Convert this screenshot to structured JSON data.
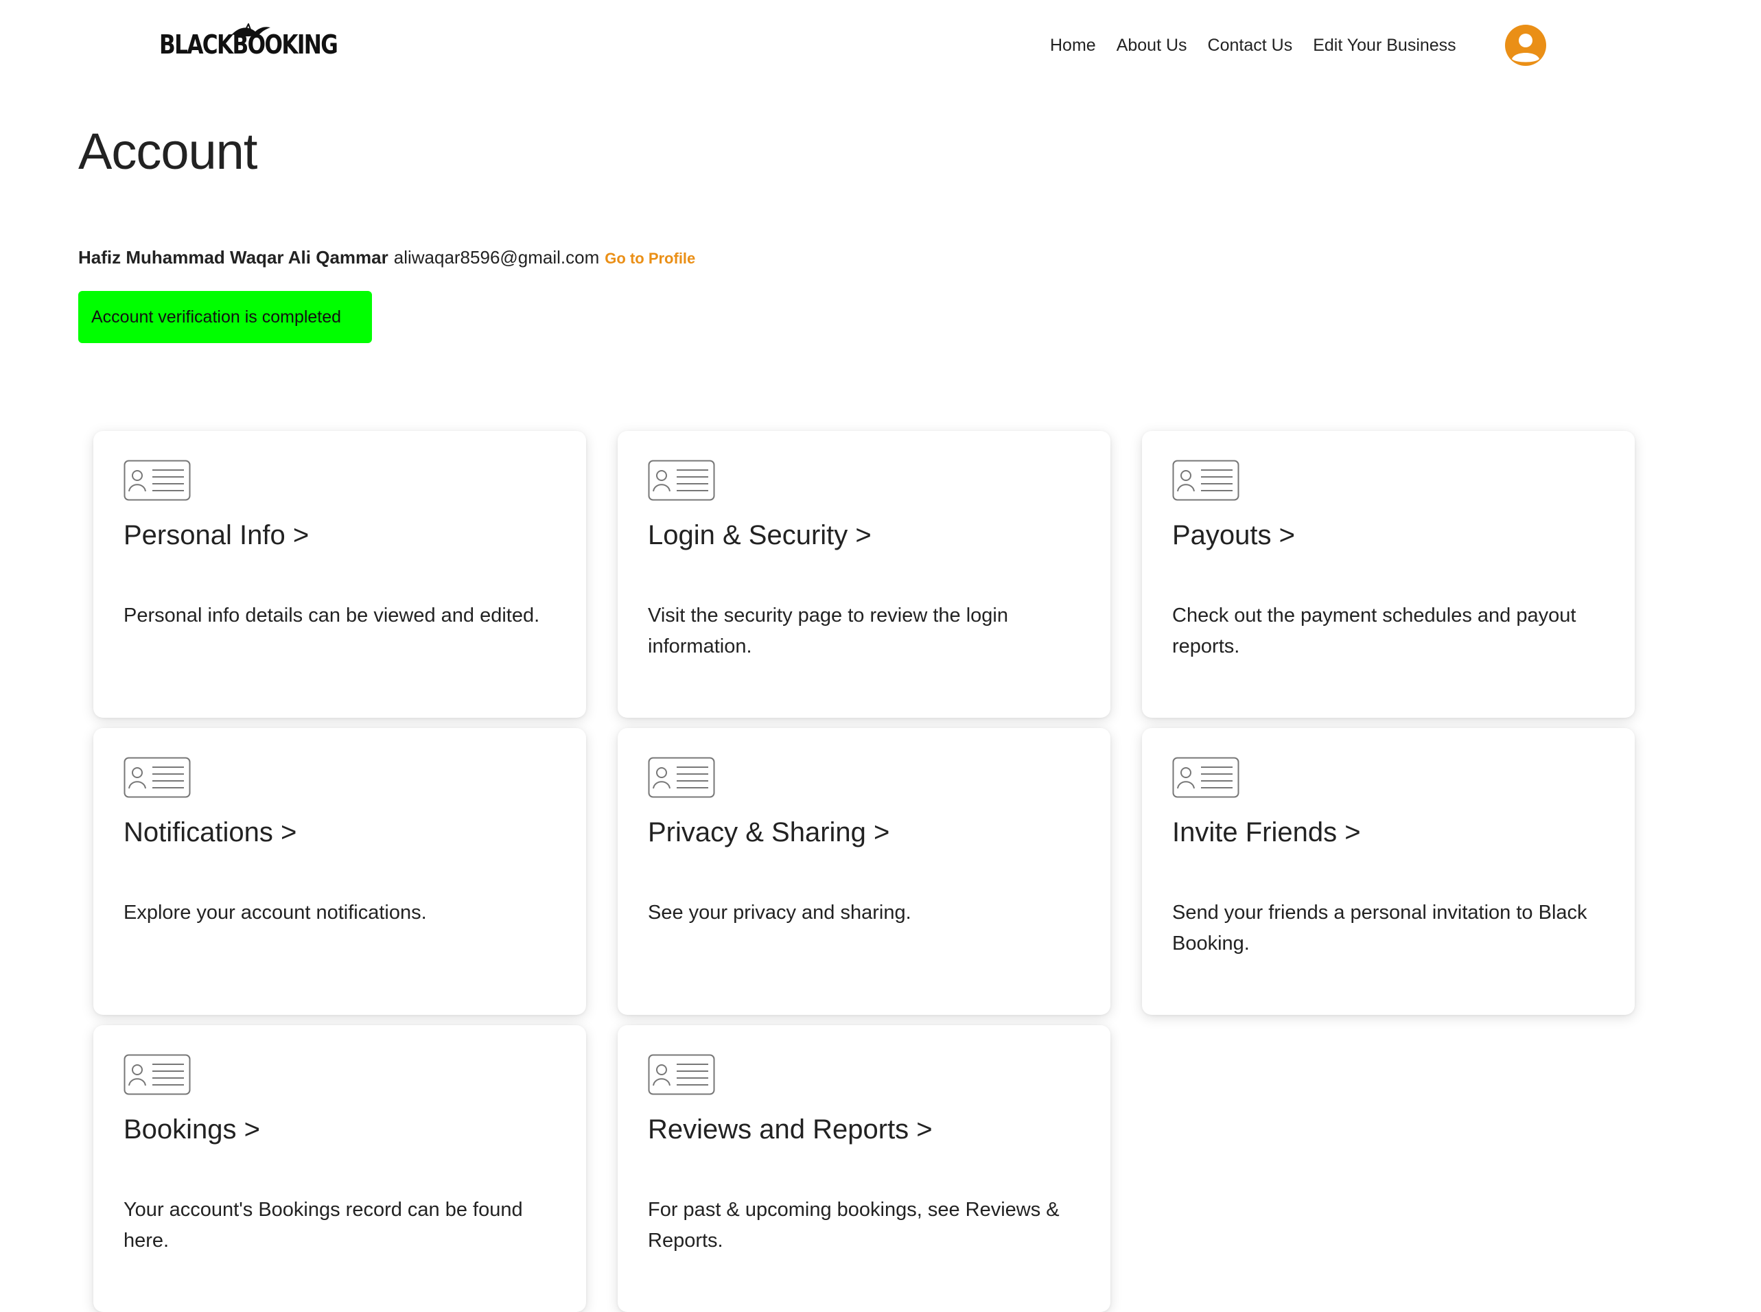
{
  "header": {
    "logo_text": "BLACKBOOKING",
    "nav": [
      {
        "label": "Home"
      },
      {
        "label": "About Us"
      },
      {
        "label": "Contact Us"
      },
      {
        "label": "Edit Your Business"
      }
    ],
    "avatar_icon": "user-icon",
    "accent_color": "#ea8f16"
  },
  "page": {
    "title": "Account"
  },
  "user": {
    "name": "Hafiz Muhammad Waqar Ali Qammar",
    "email": "aliwaqar8596@gmail.com",
    "profile_link": "Go to Profile"
  },
  "verification": {
    "message": "Account verification is completed",
    "color": "#00ff00"
  },
  "cards": [
    {
      "icon": "id-card-icon",
      "title": "Personal Info >",
      "description": "Personal info details can be viewed and edited."
    },
    {
      "icon": "id-card-icon",
      "title": "Login & Security >",
      "description": "Visit the security page to review the login information."
    },
    {
      "icon": "id-card-icon",
      "title": "Payouts >",
      "description": "Check out the payment schedules and payout reports."
    },
    {
      "icon": "id-card-icon",
      "title": "Notifications >",
      "description": "Explore your account notifications."
    },
    {
      "icon": "id-card-icon",
      "title": "Privacy & Sharing >",
      "description": "See your privacy and sharing."
    },
    {
      "icon": "id-card-icon",
      "title": "Invite Friends >",
      "description": "Send your friends a personal invitation to Black Booking."
    },
    {
      "icon": "id-card-icon",
      "title": "Bookings >",
      "description": "Your account's Bookings record can be found here."
    },
    {
      "icon": "id-card-icon",
      "title": "Reviews and Reports >",
      "description": "For past & upcoming bookings, see Reviews & Reports."
    }
  ]
}
